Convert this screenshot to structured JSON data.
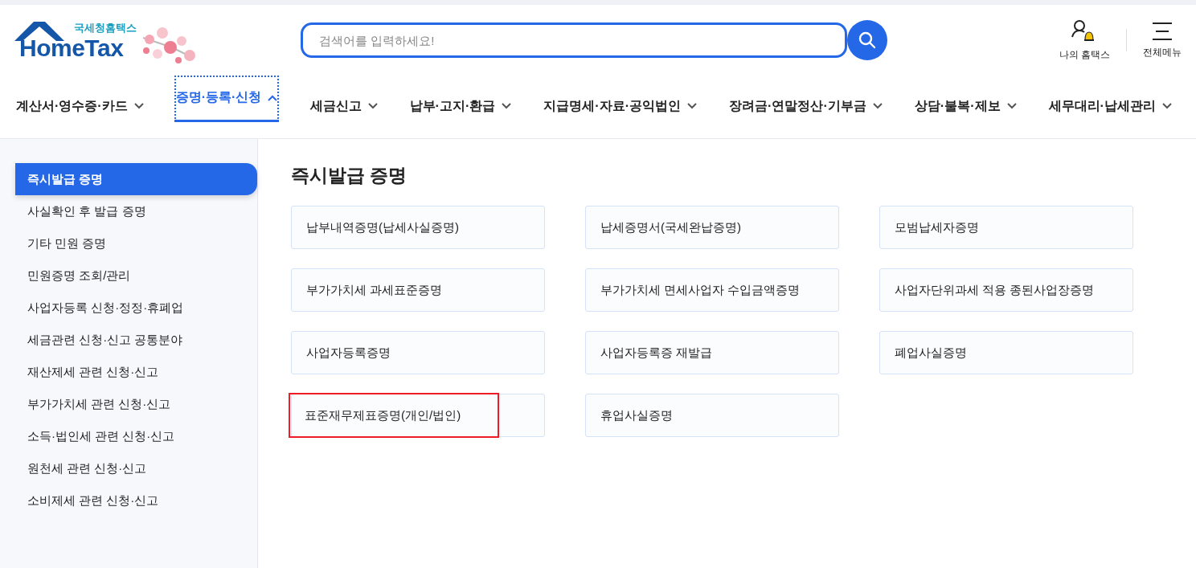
{
  "logo": {
    "subtitle": "국세청홈택스",
    "name": "HomeTax"
  },
  "search": {
    "placeholder": "검색어를 입력하세요!"
  },
  "header_links": [
    {
      "kind": "my",
      "label": "나의 홈택스"
    },
    {
      "kind": "menu",
      "label": "전체메뉴"
    }
  ],
  "nav": [
    {
      "label": "계산서·영수증·카드",
      "selected": false
    },
    {
      "label": "증명·등록·신청",
      "selected": true
    },
    {
      "label": "세금신고",
      "selected": false
    },
    {
      "label": "납부·고지·환급",
      "selected": false
    },
    {
      "label": "지급명세·자료·공익법인",
      "selected": false
    },
    {
      "label": "장려금·연말정산·기부금",
      "selected": false
    },
    {
      "label": "상담·불복·제보",
      "selected": false
    },
    {
      "label": "세무대리·납세관리",
      "selected": false
    }
  ],
  "sidebar": {
    "items": [
      {
        "label": "즉시발급 증명",
        "selected": true
      },
      {
        "label": "사실확인 후 발급 증명",
        "selected": false
      },
      {
        "label": "기타 민원 증명",
        "selected": false
      },
      {
        "label": "민원증명 조회/관리",
        "selected": false
      },
      {
        "label": "사업자등록 신청·정정·휴폐업",
        "selected": false
      },
      {
        "label": "세금관련 신청·신고 공통분야",
        "selected": false
      },
      {
        "label": "재산제세 관련 신청·신고",
        "selected": false
      },
      {
        "label": "부가가치세 관련 신청·신고",
        "selected": false
      },
      {
        "label": "소득·법인세 관련 신청·신고",
        "selected": false
      },
      {
        "label": "원천세 관련 신청·신고",
        "selected": false
      },
      {
        "label": "소비제세 관련 신청·신고",
        "selected": false
      }
    ]
  },
  "content": {
    "title": "즉시발급 증명",
    "items": [
      {
        "label": "납부내역증명(납세사실증명)",
        "highlighted": false
      },
      {
        "label": "납세증명서(국세완납증명)",
        "highlighted": false
      },
      {
        "label": "모범납세자증명",
        "highlighted": false
      },
      {
        "label": "부가가치세 과세표준증명",
        "highlighted": false
      },
      {
        "label": "부가가치세 면세사업자 수입금액증명",
        "highlighted": false
      },
      {
        "label": "사업자단위과세 적용 종된사업장증명",
        "highlighted": false
      },
      {
        "label": "사업자등록증명",
        "highlighted": false
      },
      {
        "label": "사업자등록증 재발급",
        "highlighted": false
      },
      {
        "label": "폐업사실증명",
        "highlighted": false
      },
      {
        "label": "표준재무제표증명(개인/법인)",
        "highlighted": true
      },
      {
        "label": "휴업사실증명",
        "highlighted": false
      }
    ]
  }
}
